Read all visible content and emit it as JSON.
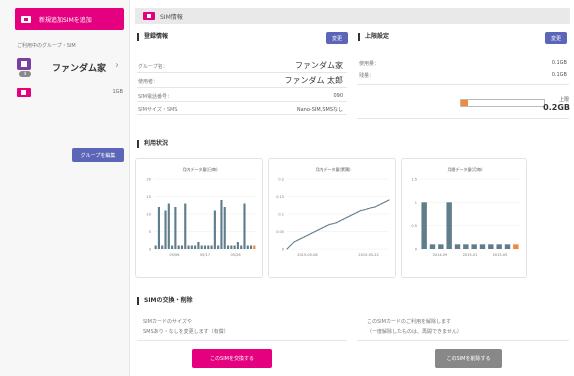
{
  "sidebar": {
    "add_sim_label": "新規追加SIMを追加",
    "group_heading": "ご利用中のグループ・SIM",
    "group_name": "ファンダム家",
    "group_count": "4",
    "sim_capacity": "1GB",
    "edit_group_label": "グループを編集"
  },
  "main": {
    "header_title": "SIM情報",
    "registration": {
      "title": "登録情報",
      "change_label": "変更",
      "group_name_label": "グループ名：",
      "group_name_value": "ファンダム家",
      "user_label": "使用者：",
      "user_value": "ファンダム 太郎",
      "phone_label": "SIM電話番号：",
      "phone_value": "090",
      "size_label": "SIMサイズ・SMS",
      "size_value": "Nano-SIM,SMSなし"
    },
    "limit": {
      "title": "上限設定",
      "change_label": "変更",
      "used_label": "使用量：",
      "used_value": "0.1GB",
      "remaining_label": "残量：",
      "remaining_value": "0.1GB",
      "limit_label": "上限",
      "limit_value": "0.2GB",
      "progress_fraction": 0.08
    },
    "usage": {
      "title": "利用状況"
    },
    "swap": {
      "title": "SIMの交換・削除",
      "desc_left_1": "SIMカードのサイズや",
      "desc_left_2": "SMSあり・なしを変更します（有償）",
      "desc_right_1": "このSIMカードのご利用を解除します",
      "desc_right_2": "（一度解除したものは、再開できません）",
      "exchange_label": "このSIMを交換する",
      "delete_label": "このSIMを削除する"
    }
  },
  "chart_data": [
    {
      "type": "bar",
      "title": "月内データ量(日毎)",
      "ylim": [
        0,
        20
      ],
      "yticks": [
        "20",
        "15",
        "10",
        "5",
        "0"
      ],
      "xticks": [
        "05/06",
        "05/17",
        "05/28"
      ],
      "values": [
        1,
        12,
        1,
        11,
        13,
        1,
        12,
        1,
        1,
        13,
        1,
        1,
        1,
        2,
        1,
        1,
        1,
        1,
        11,
        1,
        14,
        12,
        1,
        1,
        1,
        2,
        1,
        13,
        1,
        1,
        1
      ],
      "colors": {
        "bar": "#607d8b",
        "current": "#f0883e"
      }
    },
    {
      "type": "line",
      "title": "月内データ量(累積)",
      "ylim": [
        0,
        0.2
      ],
      "yticks": [
        "0.2",
        "0.15",
        "0.1",
        "0.05",
        "0"
      ],
      "xticks": [
        "2015-05-08",
        "2015-05-22"
      ],
      "values": [
        0.0,
        0.01,
        0.02,
        0.025,
        0.03,
        0.035,
        0.04,
        0.045,
        0.05,
        0.055,
        0.06,
        0.065,
        0.07,
        0.072,
        0.075,
        0.08,
        0.085,
        0.09,
        0.095,
        0.1,
        0.105,
        0.11,
        0.112,
        0.115,
        0.118,
        0.12,
        0.125,
        0.13,
        0.135,
        0.14
      ],
      "colors": {
        "line": "#607d8b"
      }
    },
    {
      "type": "bar",
      "title": "月間データ量(月毎)",
      "ylim": [
        0,
        1.5
      ],
      "yticks": [
        "1.5",
        "1",
        "0.5",
        "0"
      ],
      "xticks": [
        "2014-09",
        "2015-01",
        "2015-05"
      ],
      "values": [
        1.0,
        0.1,
        0.1,
        1.0,
        0.1,
        0.1,
        0.1,
        0.1,
        0.1,
        0.1,
        0.1,
        0.1
      ],
      "colors": {
        "bar": "#607d8b",
        "current": "#f0883e"
      }
    }
  ]
}
